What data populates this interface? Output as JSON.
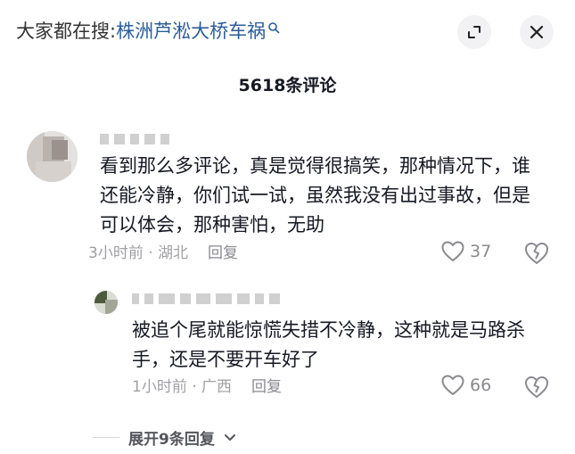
{
  "header": {
    "search_prefix": "大家都在搜:",
    "search_term": "株洲芦淞大桥车祸"
  },
  "comments_panel": {
    "count_label": "5618条评论"
  },
  "comment": {
    "text": "看到那么多评论，真是觉得很搞笑，那种情况下，谁还能冷静，你们试一试，虽然我没有出过事故，但是可以体会，那种害怕，无助",
    "meta": "3小时前 · 湖北",
    "reply_label": "回复",
    "likes": "37"
  },
  "reply": {
    "text": "被追个尾就能惊慌失措不冷静，这种就是马路杀手，还是不要开车好了",
    "meta": "1小时前 · 广西",
    "reply_label": "回复",
    "likes": "66"
  },
  "expand": {
    "label": "展开9条回复"
  }
}
